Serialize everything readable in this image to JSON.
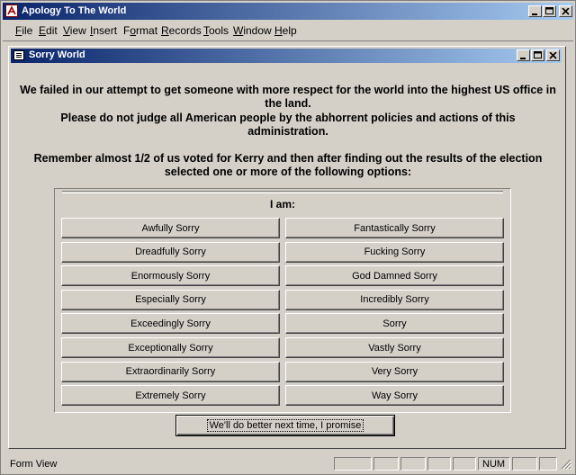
{
  "app": {
    "title": "Apology To The World"
  },
  "menu": [
    "File",
    "Edit",
    "View",
    "Insert",
    "Format",
    "Records",
    "Tools",
    "Window",
    "Help"
  ],
  "menu_mnemonic_index": [
    0,
    0,
    0,
    0,
    1,
    0,
    0,
    0,
    0
  ],
  "form": {
    "title": "Sorry World",
    "message1": "We failed in our attempt to get someone with more respect for the world into the highest US office in the land.",
    "message2": "Please do not judge all American people by the abhorrent policies and actions of this administration.",
    "message3": "Remember almost 1/2 of us voted for Kerry and then after finding out the results of the election selected one or more of the following options:",
    "group_label": "I am:",
    "options_left": [
      "Awfully Sorry",
      "Dreadfully Sorry",
      "Enormously Sorry",
      "Especially Sorry",
      "Exceedingly Sorry",
      "Exceptionally Sorry",
      "Extraordinarily Sorry",
      "Extremely Sorry"
    ],
    "options_right": [
      "Fantastically Sorry",
      "Fucking Sorry",
      "God Damned Sorry",
      "Incredibly Sorry",
      "Sorry",
      "Vastly Sorry",
      "Very Sorry",
      "Way Sorry"
    ],
    "promise_button": "We'll do better next time, I promise"
  },
  "statusbar": {
    "text": "Form View",
    "num": "NUM"
  }
}
